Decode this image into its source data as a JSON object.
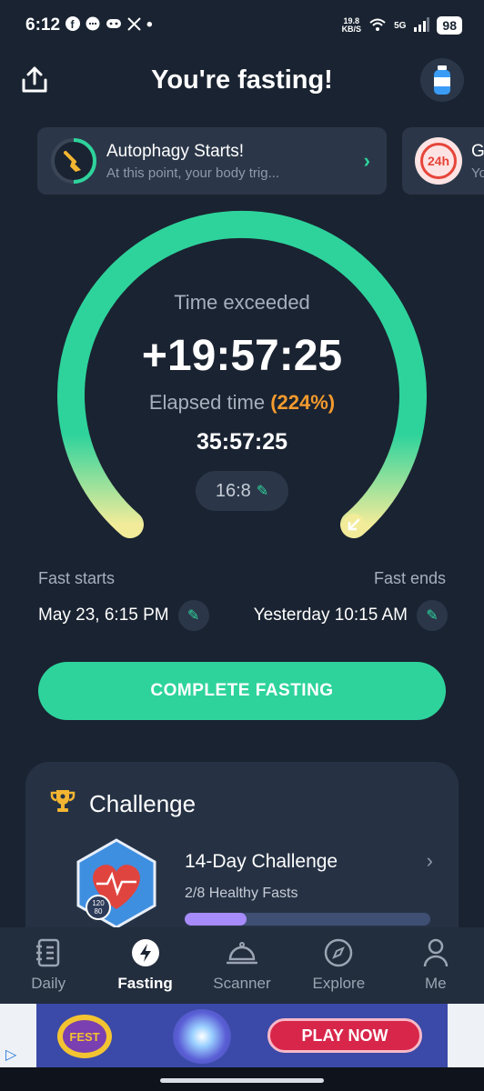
{
  "status_bar": {
    "time": "6:12",
    "icons": [
      "facebook-icon",
      "chat-icon",
      "discord-icon",
      "x-icon",
      "dot-icon"
    ],
    "speed_top": "19.8",
    "speed_bottom": "KB/S",
    "network": "5G",
    "battery": "98"
  },
  "header": {
    "title": "You're fasting!"
  },
  "cards": [
    {
      "title": "Autophagy Starts!",
      "subtitle": "At this point, your body trig..."
    },
    {
      "title": "G",
      "subtitle": "Yo",
      "icon_text": "24h"
    }
  ],
  "timer": {
    "label": "Time exceeded",
    "exceeded": "+19:57:25",
    "elapsed_label": "Elapsed time",
    "elapsed_percent": "(224%)",
    "elapsed": "35:57:25",
    "plan": "16:8"
  },
  "fast_window": {
    "start_label": "Fast starts",
    "end_label": "Fast ends",
    "start_value": "May 23, 6:15 PM",
    "end_value": "Yesterday 10:15 AM"
  },
  "complete_button": "COMPLETE FASTING",
  "challenge": {
    "heading": "Challenge",
    "name": "14-Day Challenge",
    "progress_text": "2/8 Healthy Fasts",
    "progress_fraction": 0.25,
    "badge_top": "120",
    "badge_bottom": "80"
  },
  "nav": [
    {
      "label": "Daily",
      "icon": "notebook-icon"
    },
    {
      "label": "Fasting",
      "icon": "bolt-icon"
    },
    {
      "label": "Scanner",
      "icon": "cloche-icon"
    },
    {
      "label": "Explore",
      "icon": "compass-icon"
    },
    {
      "label": "Me",
      "icon": "person-icon"
    }
  ],
  "ad": {
    "cta": "PLAY NOW",
    "logo_text": "FEST"
  },
  "colors": {
    "background": "#1a2331",
    "accent": "#2ed39c",
    "warning": "#f39a2e",
    "card": "#2b3749"
  }
}
